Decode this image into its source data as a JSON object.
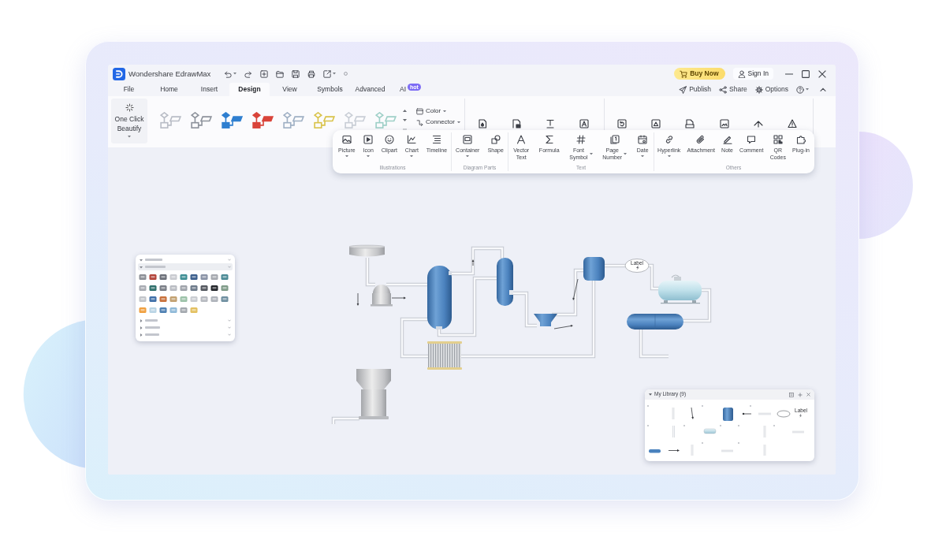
{
  "window": {
    "title": "Wondershare EdrawMax",
    "buy_button": "Buy Now",
    "sign_in_button": "Sign In"
  },
  "menu_tabs": [
    {
      "label": "File",
      "selected": false
    },
    {
      "label": "Home",
      "selected": false
    },
    {
      "label": "Insert",
      "selected": false
    },
    {
      "label": "Design",
      "selected": true
    },
    {
      "label": "View",
      "selected": false
    },
    {
      "label": "Symbols",
      "selected": false
    },
    {
      "label": "Advanced",
      "selected": false
    },
    {
      "label": "AI",
      "selected": false,
      "badge": "hot"
    }
  ],
  "menu_actions": [
    {
      "label": "Publish"
    },
    {
      "label": "Share"
    },
    {
      "label": "Options"
    }
  ],
  "ribbon": {
    "beautify_button": "One Click Beautify",
    "style_thumbnails": [
      {
        "kind": "outline",
        "color": "#b9bdc6"
      },
      {
        "kind": "outline",
        "color": "#8e939c"
      },
      {
        "kind": "filled",
        "color": "#2f7fd0"
      },
      {
        "kind": "filled",
        "color": "#d9443a"
      },
      {
        "kind": "outline",
        "color": "#9fb0c4"
      },
      {
        "kind": "outline",
        "color": "#d9c34a"
      },
      {
        "kind": "outline",
        "color": "#c9ced6"
      },
      {
        "kind": "outline",
        "color": "#9fd0c8"
      }
    ],
    "format_options": [
      {
        "label": "Color"
      },
      {
        "label": "Connector"
      }
    ]
  },
  "floating_toolbar": {
    "groups": [
      {
        "label": "Illustrations",
        "items": [
          {
            "label": "Picture",
            "dropdown": true
          },
          {
            "label": "Icon",
            "dropdown": true
          },
          {
            "label": "Clipart",
            "dropdown": false
          },
          {
            "label": "Chart",
            "dropdown": true
          },
          {
            "label": "Timeline",
            "dropdown": false
          }
        ]
      },
      {
        "label": "Diagram Parts",
        "items": [
          {
            "label": "Container",
            "dropdown": true
          },
          {
            "label": "Shape",
            "dropdown": false
          }
        ]
      },
      {
        "label": "Text",
        "items": [
          {
            "label": "Vector Text",
            "dropdown": false
          },
          {
            "label": "Formula",
            "dropdown": false
          },
          {
            "label": "Font Symbol",
            "dropdown": true
          },
          {
            "label": "Page Number",
            "dropdown": true
          },
          {
            "label": "Date",
            "dropdown": true
          }
        ]
      },
      {
        "label": "Others",
        "items": [
          {
            "label": "Hyperlink",
            "dropdown": true
          },
          {
            "label": "Attachment",
            "dropdown": false
          },
          {
            "label": "Note",
            "dropdown": false
          },
          {
            "label": "Comment",
            "dropdown": false
          },
          {
            "label": "QR Codes",
            "dropdown": false
          },
          {
            "label": "Plug-in",
            "dropdown": false
          }
        ]
      }
    ]
  },
  "canvas": {
    "diagram": {
      "shape_label": "Label"
    },
    "my_library": {
      "title": "My Library (9)",
      "item_label": "Label"
    }
  }
}
